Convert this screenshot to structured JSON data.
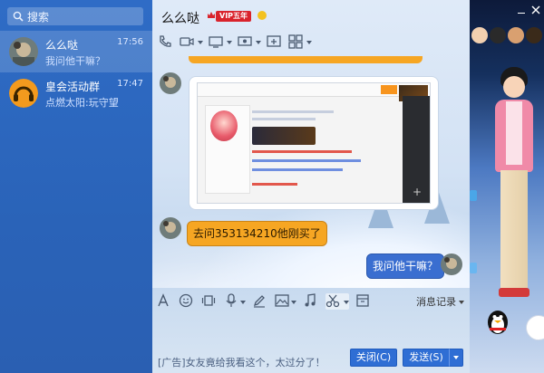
{
  "search": {
    "placeholder": "搜索"
  },
  "contacts": [
    {
      "name": "么么哒",
      "preview": "我问他干嘛？",
      "time": "17:56",
      "selected": true
    },
    {
      "name": "皇会活动群",
      "preview": "点燃太阳:玩守望",
      "time": "17:47",
      "selected": false
    }
  ],
  "chat": {
    "title": "么么哒",
    "vip_badge": "VIP五年",
    "messages": [
      {
        "type": "image",
        "side": "left"
      },
      {
        "type": "text",
        "side": "left",
        "text": "去问353134210他刚买了"
      },
      {
        "type": "text",
        "side": "right",
        "text": "我问他干嘛？"
      }
    ],
    "history_label": "消息记录",
    "ad_text": "[广告]女友竟给我看这个，太过分了！",
    "close_button": "关闭(C)",
    "send_button": "发送(S)"
  },
  "screenshot_thumb": {
    "title_text": "",
    "orange_tab_label": ""
  },
  "colors": {
    "sidebar": "#2f6cc6",
    "selected_row": "#4a86d8",
    "bubble_left": "#f6a623",
    "bubble_right": "#3a6ed0",
    "button": "#2f6ed4"
  },
  "icons": {
    "toolbar": [
      "phone-icon",
      "video-call-icon",
      "screen-share-icon",
      "remote-desktop-icon",
      "add-member-icon",
      "apps-grid-icon"
    ],
    "input_toolbar": [
      "font-icon",
      "emoji-icon",
      "shake-icon",
      "voice-icon",
      "draw-icon",
      "image-icon",
      "music-icon",
      "screenshot-icon",
      "document-icon"
    ]
  }
}
